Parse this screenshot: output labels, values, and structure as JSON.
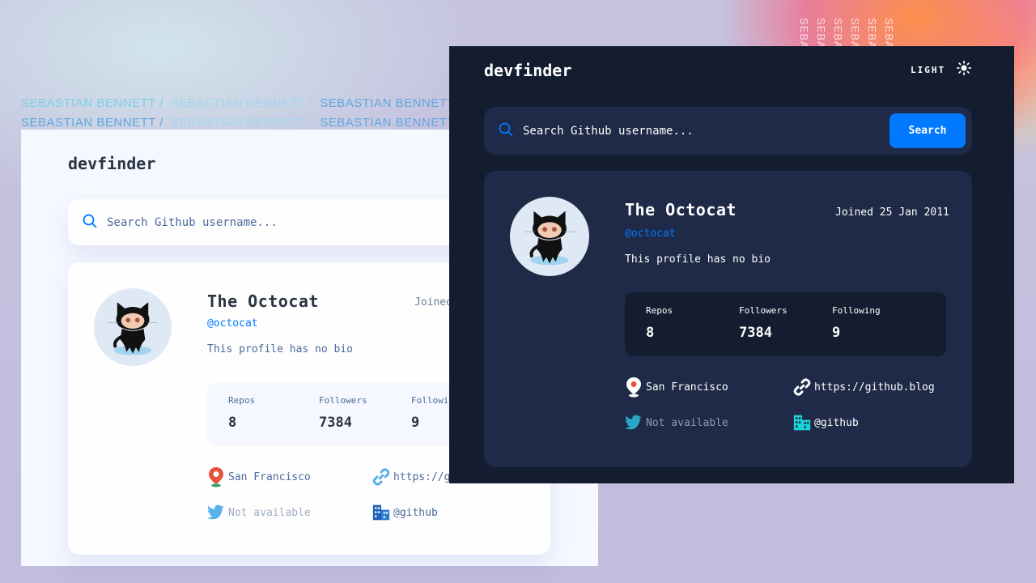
{
  "background": {
    "name_lines": [
      [
        "SEBASTIAN BENNETT /",
        "SEBASTIAN BENNETT /",
        "SEBASTIAN BENNETT /"
      ],
      [
        "SEBASTIAN BENNETT /",
        "SEBASTIAN BENNETT /",
        "SEBASTIAN BENNETT /"
      ]
    ],
    "vertical_names": [
      "SEBASTIAN",
      "SEBASTIAN",
      "SEBASTIAN",
      "SEBASTIAN",
      "SEBASTIAN",
      "SEBASTIAN"
    ]
  },
  "light": {
    "logo": "devfinder",
    "search": {
      "placeholder": "Search Github username..."
    },
    "profile": {
      "name": "The Octocat",
      "handle": "@octocat",
      "bio": "This profile has no bio",
      "joined": "Joined"
    },
    "stats": [
      {
        "label": "Repos",
        "value": "8"
      },
      {
        "label": "Followers",
        "value": "7384"
      },
      {
        "label": "Followi",
        "value": "9"
      }
    ],
    "info": {
      "location": "San Francisco",
      "blog": "https://g",
      "twitter": "Not available",
      "company": "@github"
    }
  },
  "dark": {
    "logo": "devfinder",
    "theme_label": "LIGHT",
    "search": {
      "placeholder": "Search Github username...",
      "button": "Search"
    },
    "profile": {
      "name": "The Octocat",
      "handle": "@octocat",
      "bio": "This profile has no bio",
      "joined": "Joined 25 Jan 2011"
    },
    "stats": [
      {
        "label": "Repos",
        "value": "8"
      },
      {
        "label": "Followers",
        "value": "7384"
      },
      {
        "label": "Following",
        "value": "9"
      }
    ],
    "info": {
      "location": "San Francisco",
      "blog": "https://github.blog",
      "twitter": "Not available",
      "company": "@github"
    }
  },
  "colors": {
    "accent": "#0079ff",
    "dark_bg": "#141d2f",
    "dark_card": "#1e2a47",
    "light_bg": "#f6f8ff"
  }
}
